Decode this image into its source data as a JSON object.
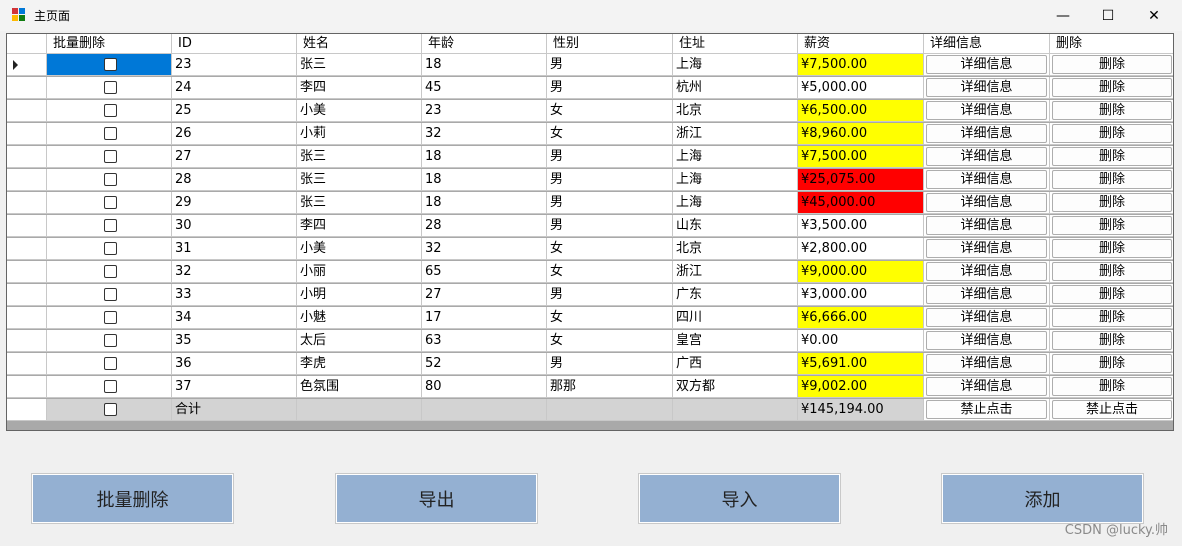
{
  "window": {
    "title": "主页面",
    "minimize_icon": "—",
    "maximize_icon": "☐",
    "close_icon": "✕"
  },
  "grid": {
    "headers": [
      "批量删除",
      "ID",
      "姓名",
      "年龄",
      "性别",
      "住址",
      "薪资",
      "详细信息",
      "删除"
    ],
    "rows": [
      {
        "id": "23",
        "name": "张三",
        "age": "18",
        "gender": "男",
        "addr": "上海",
        "salary": "¥7,500.00",
        "hl": "yellow"
      },
      {
        "id": "24",
        "name": "李四",
        "age": "45",
        "gender": "男",
        "addr": "杭州",
        "salary": "¥5,000.00",
        "hl": "none"
      },
      {
        "id": "25",
        "name": "小美",
        "age": "23",
        "gender": "女",
        "addr": "北京",
        "salary": "¥6,500.00",
        "hl": "yellow"
      },
      {
        "id": "26",
        "name": "小莉",
        "age": "32",
        "gender": "女",
        "addr": "浙江",
        "salary": "¥8,960.00",
        "hl": "yellow"
      },
      {
        "id": "27",
        "name": "张三",
        "age": "18",
        "gender": "男",
        "addr": "上海",
        "salary": "¥7,500.00",
        "hl": "yellow"
      },
      {
        "id": "28",
        "name": "张三",
        "age": "18",
        "gender": "男",
        "addr": "上海",
        "salary": "¥25,075.00",
        "hl": "red"
      },
      {
        "id": "29",
        "name": "张三",
        "age": "18",
        "gender": "男",
        "addr": "上海",
        "salary": "¥45,000.00",
        "hl": "red"
      },
      {
        "id": "30",
        "name": "李四",
        "age": "28",
        "gender": "男",
        "addr": "山东",
        "salary": "¥3,500.00",
        "hl": "none"
      },
      {
        "id": "31",
        "name": "小美",
        "age": "32",
        "gender": "女",
        "addr": "北京",
        "salary": "¥2,800.00",
        "hl": "none"
      },
      {
        "id": "32",
        "name": "小丽",
        "age": "65",
        "gender": "女",
        "addr": "浙江",
        "salary": "¥9,000.00",
        "hl": "yellow"
      },
      {
        "id": "33",
        "name": "小明",
        "age": "27",
        "gender": "男",
        "addr": "广东",
        "salary": "¥3,000.00",
        "hl": "none"
      },
      {
        "id": "34",
        "name": "小魅",
        "age": "17",
        "gender": "女",
        "addr": "四川",
        "salary": "¥6,666.00",
        "hl": "yellow"
      },
      {
        "id": "35",
        "name": "太后",
        "age": "63",
        "gender": "女",
        "addr": "皇宫",
        "salary": "¥0.00",
        "hl": "none"
      },
      {
        "id": "36",
        "name": "李虎",
        "age": "52",
        "gender": "男",
        "addr": "广西",
        "salary": "¥5,691.00",
        "hl": "yellow"
      },
      {
        "id": "37",
        "name": "色氛围",
        "age": "80",
        "gender": "那那",
        "addr": "双方都",
        "salary": "¥9,002.00",
        "hl": "yellow"
      }
    ],
    "detail_button_label": "详细信息",
    "delete_button_label": "删除",
    "total_row": {
      "label": "合计",
      "salary": "¥145,194.00",
      "disabled_label": "禁止点击"
    }
  },
  "buttons": {
    "batch_delete": "批量删除",
    "export": "导出",
    "import": "导入",
    "add": "添加"
  },
  "watermark": "CSDN @lucky.帅",
  "colors": {
    "yellow": "#ffff00",
    "red": "#ff0000",
    "selected": "#0078d7",
    "button_blue": "#94b0d2"
  }
}
